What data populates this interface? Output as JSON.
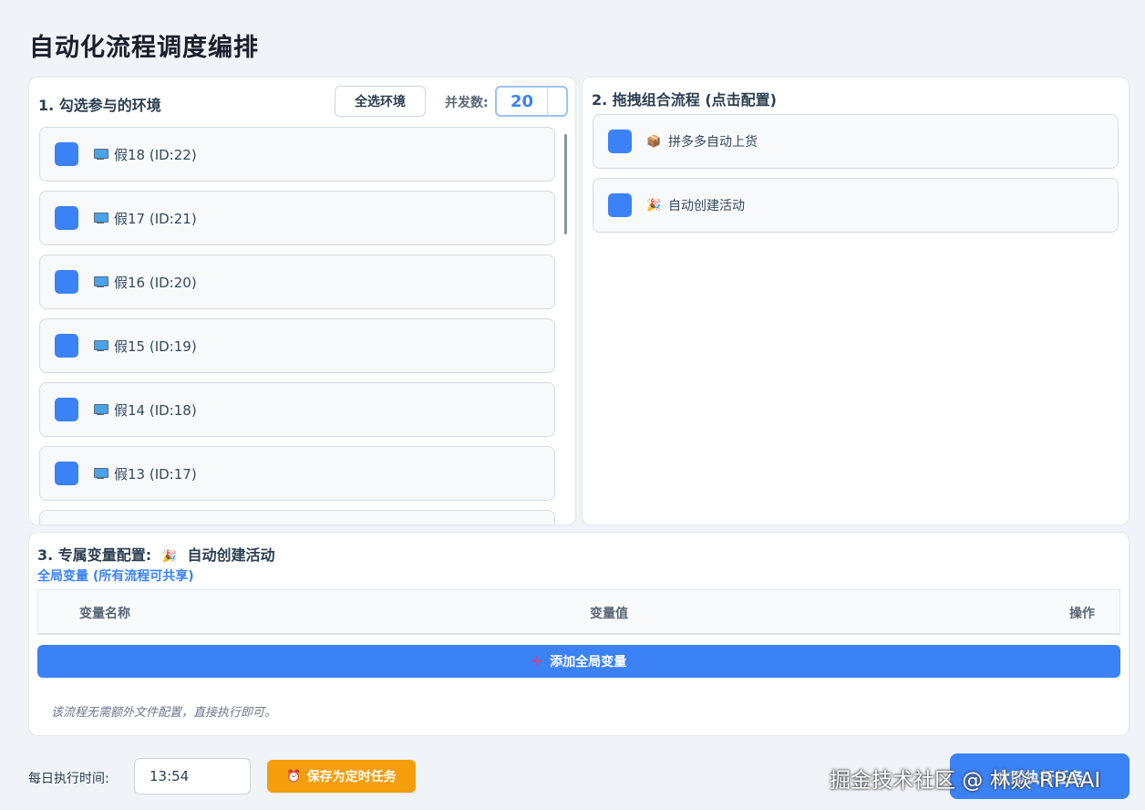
{
  "page": {
    "title": "自动化流程调度编排"
  },
  "env_panel": {
    "heading": "1. 勾选参与的环境",
    "select_all_label": "全选环境",
    "concurrency_label": "并发数:",
    "concurrency_value": "20",
    "items": [
      {
        "label": "假18 (ID:22)"
      },
      {
        "label": "假17 (ID:21)"
      },
      {
        "label": "假16 (ID:20)"
      },
      {
        "label": "假15 (ID:19)"
      },
      {
        "label": "假14 (ID:18)"
      },
      {
        "label": "假13 (ID:17)"
      },
      {
        "label": ""
      }
    ]
  },
  "flow_panel": {
    "heading": "2. 拖拽组合流程 (点击配置)",
    "items": [
      {
        "icon": "package-icon",
        "glyph": "📦",
        "label": "拼多多自动上货"
      },
      {
        "icon": "party-popper-icon",
        "glyph": "🎉",
        "label": "自动创建活动"
      }
    ]
  },
  "var_panel": {
    "heading": "3. 专属变量配置:",
    "heading_icon": "🎉",
    "heading_flow": "自动创建活动",
    "global_label": "全局变量 (所有流程可共享)",
    "columns": [
      "变量名称",
      "变量值",
      "操作"
    ],
    "add_label": "添加全局变量",
    "note": "该流程无需额外文件配置，直接执行即可。"
  },
  "schedule": {
    "label": "每日执行时间:",
    "time_value": "13:54",
    "save_label": "保存为定时任务",
    "run_label": "立即执行任务"
  },
  "watermark": "掘金技术社区 @ 林焱-RPAAI",
  "colors": {
    "primary": "#3b82f6",
    "warning": "#f59e0b",
    "background": "#f0f3f7"
  }
}
